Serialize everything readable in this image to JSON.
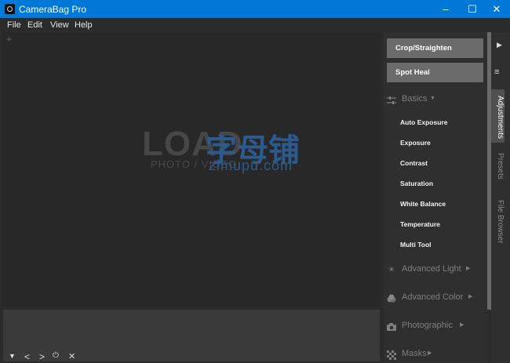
{
  "window": {
    "title": "CameraBag Pro",
    "icon": "camerabag-app-icon",
    "controls": {
      "minimize": "–",
      "maximize": "☐",
      "close": "✕"
    },
    "accent": "#0078d7"
  },
  "menu": [
    "File",
    "Edit",
    "View",
    "Help"
  ],
  "canvas": {
    "add_glyph": "+",
    "watermark": {
      "logo": "LOAD",
      "tagline": "PHOTO / VIDEO",
      "chinese": "字母铺",
      "domain": "zimupu.com"
    }
  },
  "filmstrip_controls": {
    "collapse": "▼",
    "prev": "<",
    "next": ">",
    "power": "⏻",
    "close": "✕"
  },
  "panel": {
    "tools": [
      "Crop/Straighten",
      "Spot Heal"
    ],
    "basics": {
      "label": "Basics",
      "icon": "sliders-icon",
      "items": [
        "Auto Exposure",
        "Exposure",
        "Contrast",
        "Saturation",
        "White Balance",
        "Temperature",
        "Multi Tool"
      ]
    },
    "sections": [
      {
        "label": "Advanced Light",
        "icon": "sun-icon"
      },
      {
        "label": "Advanced Color",
        "icon": "color-circles-icon"
      },
      {
        "label": "Photographic",
        "icon": "camera-icon"
      },
      {
        "label": "Masks",
        "icon": "mask-icon"
      }
    ]
  },
  "side_tabs": {
    "play": "▶",
    "menu": "≡",
    "tabs": [
      "Adjustments",
      "Presets",
      "File Browser"
    ],
    "active_tab": "Adjustments"
  }
}
